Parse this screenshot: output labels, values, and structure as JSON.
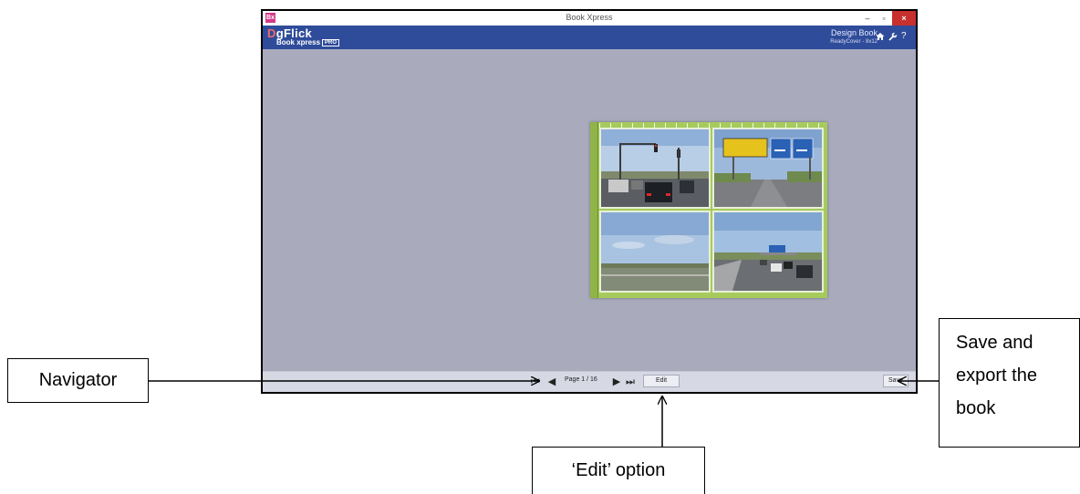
{
  "window": {
    "title": "Book Xpress",
    "app_icon": "Bx",
    "controls": {
      "minimize": "–",
      "restore": "▫",
      "close": "×"
    }
  },
  "header": {
    "logo_d": "D",
    "logo_rest": "gFlick",
    "logo_sub": "Book xpress",
    "pro_badge": "PRO",
    "mode_title": "Design Book",
    "cover_info": "ReadyCover - 8x12",
    "icons": [
      "home-icon",
      "wrench-icon",
      "help-icon"
    ],
    "help_label": "?"
  },
  "book": {
    "colors": {
      "cover": "#a6cb5c",
      "binding": "#8fb548"
    },
    "photos": [
      "highway-traffic-lights",
      "highway-road-signs",
      "open-field-sky",
      "highway-overpass"
    ]
  },
  "bottombar": {
    "first_label": "⏮",
    "prev_label": "◀",
    "page_label": "Page 1 / 16",
    "next_label": "▶",
    "last_label": "⏭",
    "edit_label": "Edit",
    "save_label": "Save"
  },
  "annotations": {
    "navigator": "Navigator",
    "edit_option": "‘Edit’ option",
    "save_lines": [
      "Save and",
      "export the",
      "book"
    ]
  }
}
